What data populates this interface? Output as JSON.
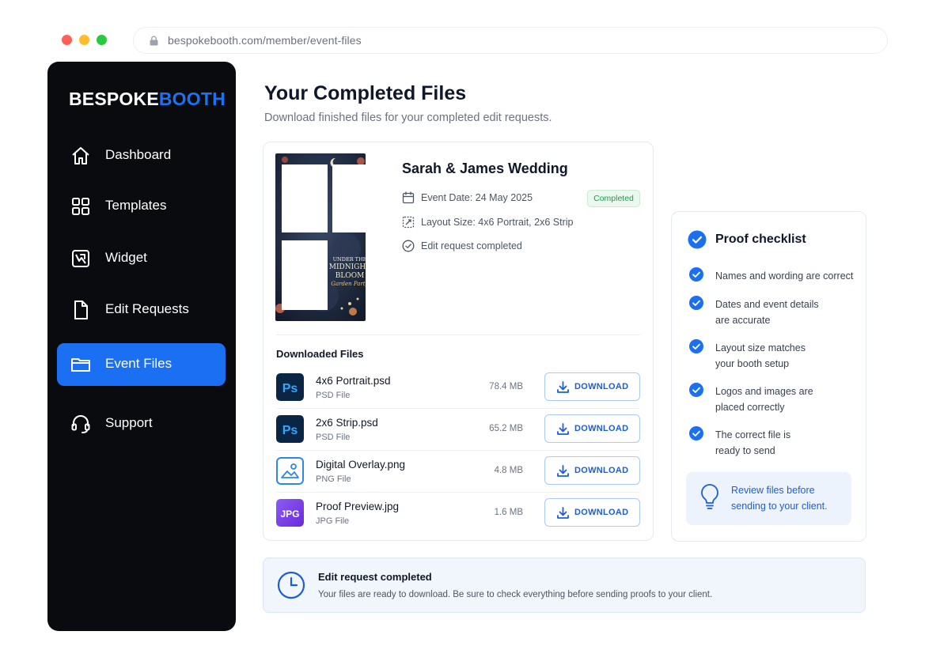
{
  "browser": {
    "url": "bespokebooth.com/member/event-files"
  },
  "sidebar": {
    "logo_part1": "BESPOKE",
    "logo_part2": "BOOTH",
    "items": [
      {
        "label": "Dashboard",
        "icon": "home-icon"
      },
      {
        "label": "Templates",
        "icon": "grid-icon"
      },
      {
        "label": "Widget",
        "icon": "widget-icon"
      },
      {
        "label": "Edit Requests",
        "icon": "document-icon"
      },
      {
        "label": "Event Files",
        "icon": "folder-icon",
        "active": true
      },
      {
        "label": "Support",
        "icon": "headset-icon"
      }
    ]
  },
  "main": {
    "title": "Your Completed Files",
    "subtitle": "Download finished files for your completed edit requests."
  },
  "event": {
    "title": "Sarah & James Wedding",
    "date": "Event Date: 24 May 2025",
    "layout": "Layout Size: 4x6 Portrait, 2x6 Strip",
    "status_text": "Edit request completed",
    "badge": "Completed",
    "thumbnail_text": "UNDER THE MIDNIGHT BLOOM Garden Party"
  },
  "files": {
    "heading": "Downloaded Files",
    "download_label": "DOWNLOAD",
    "items": [
      {
        "name": "4x6 Portrait.psd",
        "type": "PSD File",
        "size": "78.4 MB",
        "icon": "photoshop-icon",
        "icon_text": "Ps"
      },
      {
        "name": "2x6 Strip.psd",
        "type": "PSD File",
        "size": "65.2 MB",
        "icon": "photoshop-icon",
        "icon_text": "Ps"
      },
      {
        "name": "Digital Overlay.png",
        "type": "PNG File",
        "size": "4.8 MB",
        "icon": "image-icon",
        "icon_text": ""
      },
      {
        "name": "Proof Preview.jpg",
        "type": "JPG File",
        "size": "1.6 MB",
        "icon": "jpg-icon",
        "icon_text": "JPG"
      }
    ]
  },
  "checklist": {
    "title": "Proof checklist",
    "items": [
      {
        "line1": "Names and wording are correct",
        "line2": ""
      },
      {
        "line1": "Dates and event details",
        "line2": "are accurate"
      },
      {
        "line1": "Layout size matches",
        "line2": "your booth setup"
      },
      {
        "line1": "Logos and images are",
        "line2": "placed correctly"
      },
      {
        "line1": "The correct file is",
        "line2": "ready to send"
      }
    ],
    "tip_line1": "Review files before",
    "tip_line2": "sending to your client."
  },
  "banner": {
    "title": "Edit request completed",
    "text": "Your files are ready to download. Be sure to check everything before sending proofs to your client."
  },
  "colors": {
    "accent": "#1a6ff2",
    "sidebar_bg": "#0a0b0f",
    "success": "#16a34a",
    "photoshop_bg": "#0b2545",
    "photoshop_text": "#31a8ff",
    "jpg_bg": "#7c3aed"
  }
}
